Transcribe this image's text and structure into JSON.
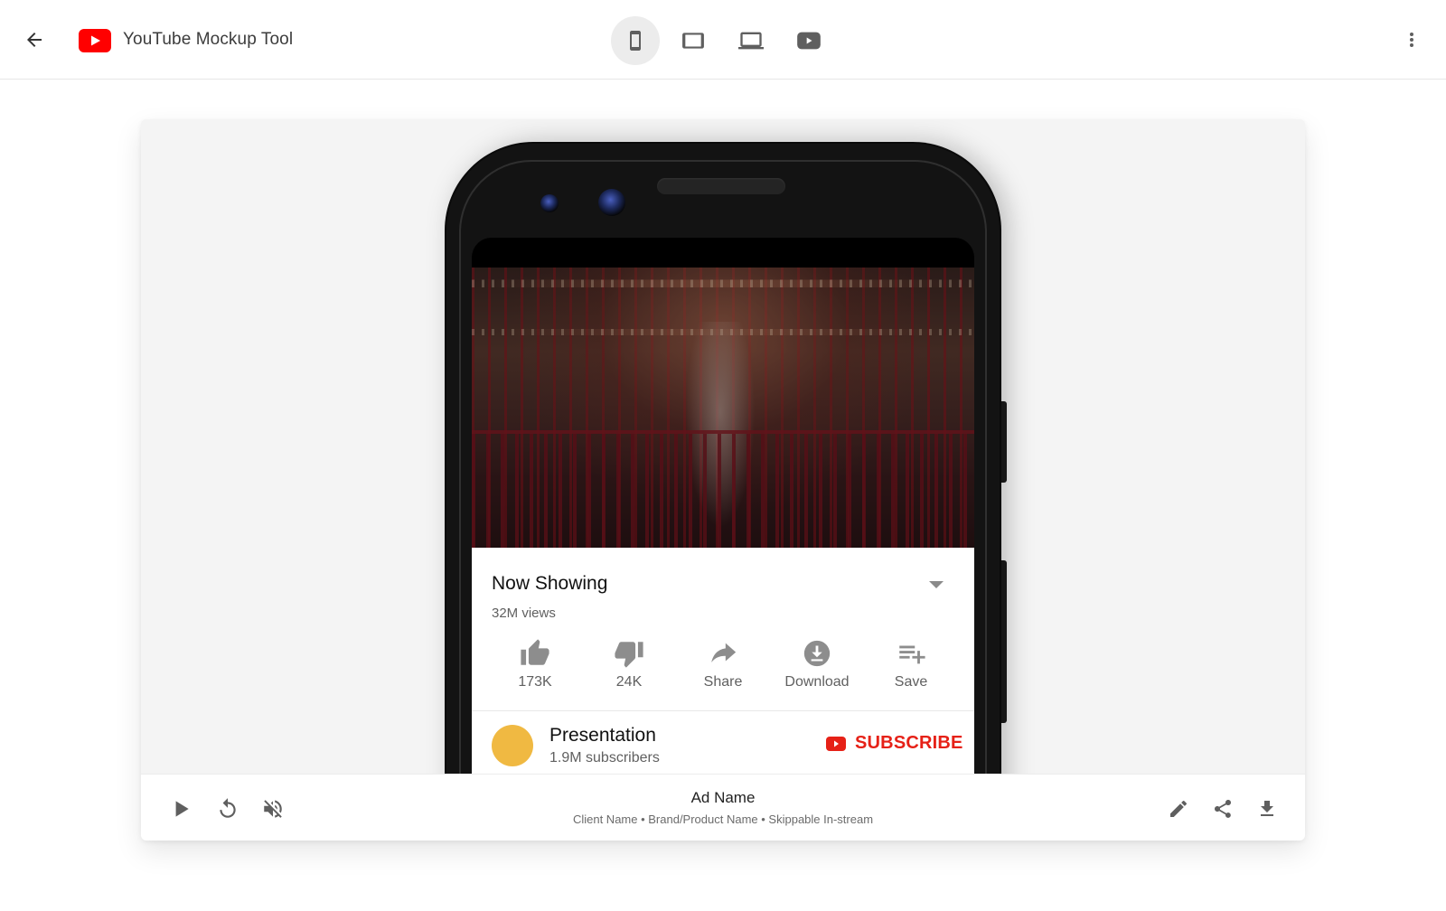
{
  "appbar": {
    "title": "YouTube Mockup Tool",
    "back_icon": "arrow-back-icon",
    "logo_icon": "youtube-logo-icon",
    "more_icon": "more-vert-icon",
    "device_modes": [
      {
        "name": "mobile",
        "icon": "smartphone-icon",
        "active": true
      },
      {
        "name": "tablet",
        "icon": "tablet-icon",
        "active": false
      },
      {
        "name": "desktop",
        "icon": "laptop-icon",
        "active": false
      },
      {
        "name": "tv",
        "icon": "youtube-tv-icon",
        "active": false
      }
    ]
  },
  "preview": {
    "video": {
      "description": "Dancer in front of carousel"
    },
    "title": "Now Showing",
    "views": "32M views",
    "actions": [
      {
        "icon": "thumb-up-icon",
        "label": "173K"
      },
      {
        "icon": "thumb-down-icon",
        "label": "24K"
      },
      {
        "icon": "share-arrow-icon",
        "label": "Share"
      },
      {
        "icon": "download-circle-icon",
        "label": "Download"
      },
      {
        "icon": "playlist-add-icon",
        "label": "Save"
      }
    ],
    "channel": {
      "name": "Presentation",
      "subscribers": "1.9M subscribers",
      "avatar_color": "#f0b942"
    },
    "subscribe_label": "SUBSCRIBE",
    "subscribe_color": "#e62117"
  },
  "controls": {
    "left": [
      {
        "icon": "play-icon",
        "label": "Play"
      },
      {
        "icon": "replay-icon",
        "label": "Replay"
      },
      {
        "icon": "volume-off-icon",
        "label": "Mute"
      }
    ],
    "ad_name": "Ad Name",
    "ad_details": "Client Name • Brand/Product Name • Skippable In-stream",
    "right": [
      {
        "icon": "edit-icon",
        "label": "Edit"
      },
      {
        "icon": "share-icon",
        "label": "Share"
      },
      {
        "icon": "download-icon",
        "label": "Download"
      }
    ]
  },
  "colors": {
    "brand_red": "#ff0000",
    "icon_gray": "#5f5f5f",
    "card_bg": "#f4f4f4"
  }
}
